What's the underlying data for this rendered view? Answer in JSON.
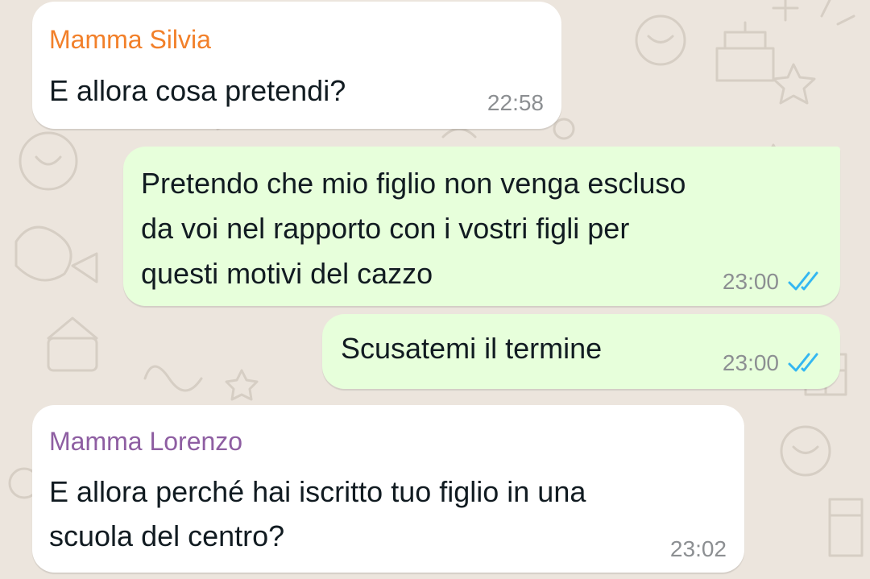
{
  "colors": {
    "incoming_bubble": "#ffffff",
    "outgoing_bubble": "#e7ffdb",
    "background": "#ece5dd",
    "read_tick": "#34b7f1",
    "sender_silvia": "#f2802a",
    "sender_lorenzo": "#8e5ea2"
  },
  "messages": [
    {
      "direction": "incoming",
      "sender": "Mamma Silvia",
      "lines": [
        "E allora cosa pretendi?"
      ],
      "time": "22:58"
    },
    {
      "direction": "outgoing",
      "lines": [
        "Pretendo che mio figlio non venga escluso",
        "da voi nel rapporto con i vostri figli per",
        "questi motivi del cazzo"
      ],
      "time": "23:00",
      "status_icon": "double-check-read-icon"
    },
    {
      "direction": "outgoing",
      "lines": [
        "Scusatemi il termine"
      ],
      "time": "23:00",
      "status_icon": "double-check-read-icon"
    },
    {
      "direction": "incoming",
      "sender": "Mamma Lorenzo",
      "lines": [
        "E allora perché hai iscritto tuo figlio in una",
        "scuola del centro?"
      ],
      "time": "23:02"
    }
  ]
}
